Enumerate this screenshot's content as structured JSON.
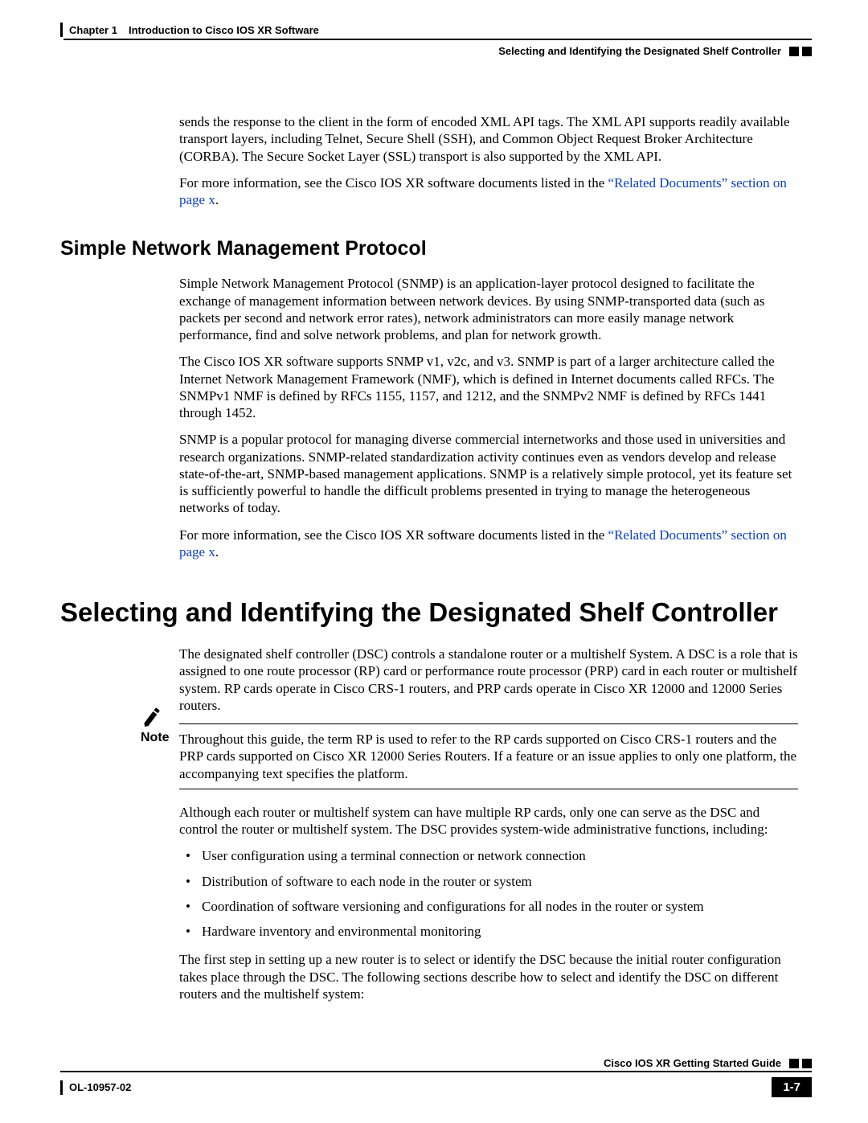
{
  "header": {
    "chapter_label": "Chapter 1",
    "chapter_title": "Introduction to Cisco IOS XR Software",
    "section_title": "Selecting and Identifying the Designated Shelf Controller"
  },
  "intro": {
    "p1": "sends the response to the client in the form of encoded XML API tags. The XML API supports readily available transport layers, including Telnet, Secure Shell (SSH), and Common Object Request Broker Architecture (CORBA). The Secure Socket Layer (SSL) transport is also supported by the XML API.",
    "p2_pre": "For more information, see the Cisco IOS XR software documents listed in the ",
    "p2_link": "“Related Documents” section on page x",
    "p2_post": "."
  },
  "snmp": {
    "heading": "Simple Network Management Protocol",
    "p1": "Simple Network Management Protocol (SNMP) is an application-layer protocol designed to facilitate the exchange of management information between network devices. By using SNMP-transported data (such as packets per second and network error rates), network administrators can more easily manage network performance, find and solve network problems, and plan for network growth.",
    "p2": "The Cisco IOS XR software supports SNMP v1, v2c, and v3. SNMP is part of a larger architecture called the Internet Network Management Framework (NMF), which is defined in Internet documents called RFCs. The SNMPv1 NMF is defined by RFCs 1155, 1157, and 1212, and the SNMPv2 NMF is defined by RFCs 1441 through 1452.",
    "p3": "SNMP is a popular protocol for managing diverse commercial internetworks and those used in universities and research organizations. SNMP-related standardization activity continues even as vendors develop and release state-of-the-art, SNMP-based management applications. SNMP is a relatively simple protocol, yet its feature set is sufficiently powerful to handle the difficult problems presented in trying to manage the heterogeneous networks of today.",
    "p4_pre": "For more information, see the Cisco IOS XR software documents listed in the ",
    "p4_link": "“Related Documents” section on page x",
    "p4_post": "."
  },
  "dsc": {
    "heading": "Selecting and Identifying the Designated Shelf Controller",
    "p1": "The designated shelf controller (DSC) controls a standalone router or a multishelf System. A DSC is a role that is assigned to one route processor (RP) card or performance route processor (PRP) card in each router or multishelf system. RP cards operate in Cisco CRS-1 routers, and PRP cards operate in Cisco XR 12000 and 12000 Series routers.",
    "note_label": "Note",
    "note_text": "Throughout this guide, the term RP is used to refer to the RP cards supported on Cisco CRS-1 routers and the PRP cards supported on Cisco XR 12000 Series Routers. If a feature or an issue applies to only one platform, the accompanying text specifies the platform.",
    "p2": "Although each router or multishelf system can have multiple RP cards, only one can serve as the DSC and control the router or multishelf system. The DSC provides system-wide administrative functions, including:",
    "bullets": [
      "User configuration using a terminal connection or network connection",
      "Distribution of software to each node in the router or system",
      "Coordination of software versioning and configurations for all nodes in the router or system",
      "Hardware inventory and environmental monitoring"
    ],
    "p3": "The first step in setting up a new router is to select or identify the DSC because the initial router configuration takes place through the DSC. The following sections describe how to select and identify the DSC on different routers and the multishelf system:"
  },
  "footer": {
    "guide": "Cisco IOS XR Getting Started Guide",
    "docnum": "OL-10957-02",
    "pagenum": "1-7"
  }
}
